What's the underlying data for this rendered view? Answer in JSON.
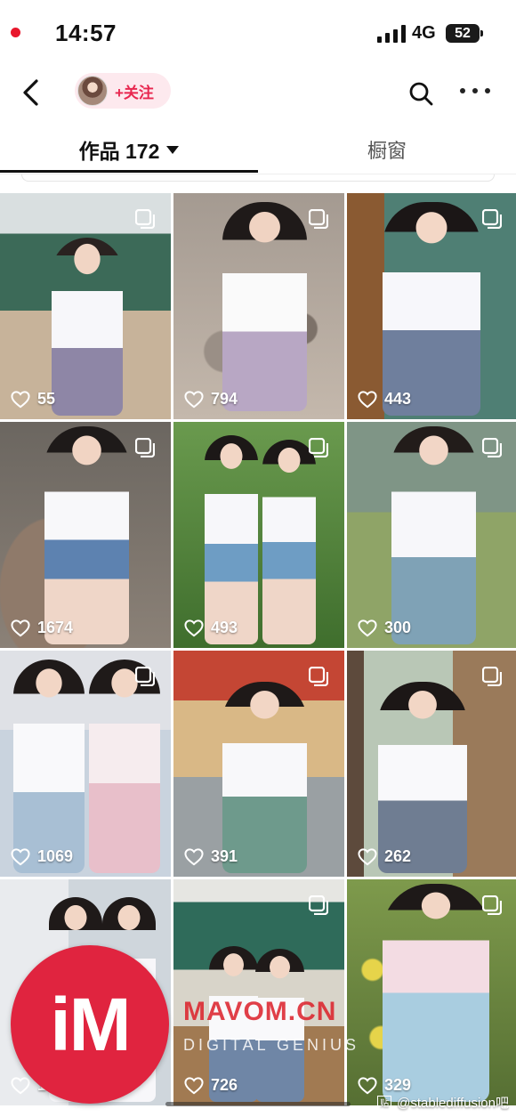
{
  "status_bar": {
    "time": "14:57",
    "network": "4G",
    "battery": "52"
  },
  "nav": {
    "follow_label": "+关注"
  },
  "tabs": {
    "works_label": "作品 172",
    "window_label": "橱窗"
  },
  "tiles": [
    {
      "likes": "55",
      "scene": "classroom"
    },
    {
      "likes": "794",
      "scene": "rubble"
    },
    {
      "likes": "443",
      "scene": "boat"
    },
    {
      "likes": "1674",
      "scene": "rocks"
    },
    {
      "likes": "493",
      "scene": "grass"
    },
    {
      "likes": "300",
      "scene": "field"
    },
    {
      "likes": "1069",
      "scene": "bed"
    },
    {
      "likes": "391",
      "scene": "carousel"
    },
    {
      "likes": "262",
      "scene": "classroom2"
    },
    {
      "likes": "1",
      "scene": "curtain"
    },
    {
      "likes": "726",
      "scene": "hall"
    },
    {
      "likes": "329",
      "scene": "flowers"
    }
  ],
  "overlays": {
    "logo_text": "iM",
    "watermark_main": "MAVOM.CN",
    "watermark_sub": "DIGITAL GENIUS",
    "credit_badge": "贴",
    "credit_text": "@stablediffusion吧"
  },
  "colors": {
    "accent": "#e8274f",
    "follow_bg": "#fde9ee",
    "logo": "#e0243f"
  }
}
